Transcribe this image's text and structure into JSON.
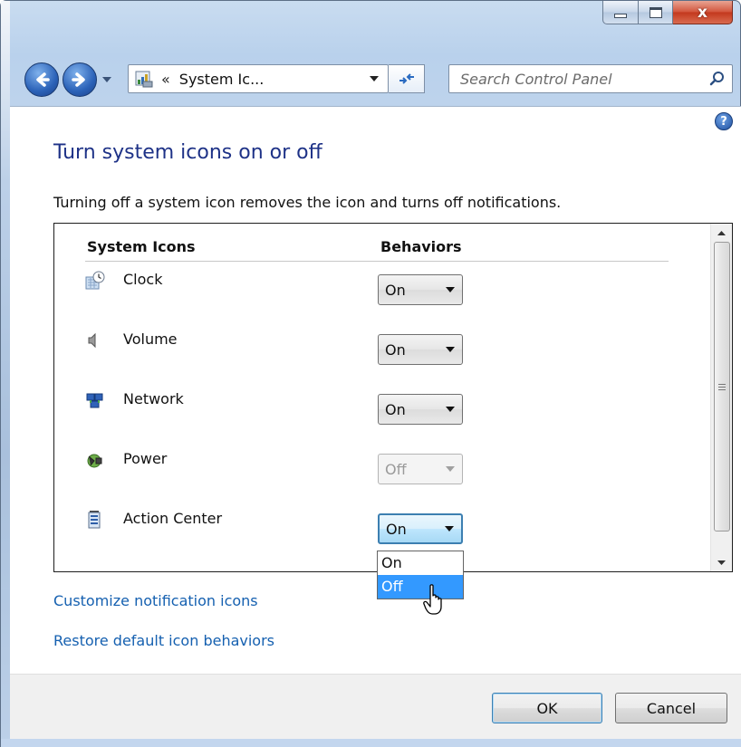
{
  "window": {
    "caption_buttons": {
      "minimize_icon": "minimize-icon",
      "maximize_icon": "maximize-icon",
      "close_glyph": "x"
    }
  },
  "navigation": {
    "address_chevrons": "«",
    "address_text": "System Ic...",
    "search_placeholder": "Search Control Panel"
  },
  "help": {
    "glyph": "?"
  },
  "page": {
    "title": "Turn system icons on or off",
    "description": "Turning off a system icon removes the icon and turns off notifications."
  },
  "table": {
    "col_system_icons": "System Icons",
    "col_behaviors": "Behaviors",
    "rows": [
      {
        "label": "Clock",
        "value": "On",
        "icon": "clock-icon",
        "state": "normal"
      },
      {
        "label": "Volume",
        "value": "On",
        "icon": "volume-icon",
        "state": "normal"
      },
      {
        "label": "Network",
        "value": "On",
        "icon": "network-icon",
        "state": "normal"
      },
      {
        "label": "Power",
        "value": "Off",
        "icon": "power-icon",
        "state": "disabled"
      },
      {
        "label": "Action Center",
        "value": "On",
        "icon": "action-center-icon",
        "state": "focused"
      }
    ]
  },
  "dropdown": {
    "options": [
      "On",
      "Off"
    ],
    "highlighted": "Off"
  },
  "links": {
    "customize": "Customize notification icons",
    "restore": "Restore default icon behaviors"
  },
  "footer": {
    "ok_label": "OK",
    "cancel_label": "Cancel"
  }
}
